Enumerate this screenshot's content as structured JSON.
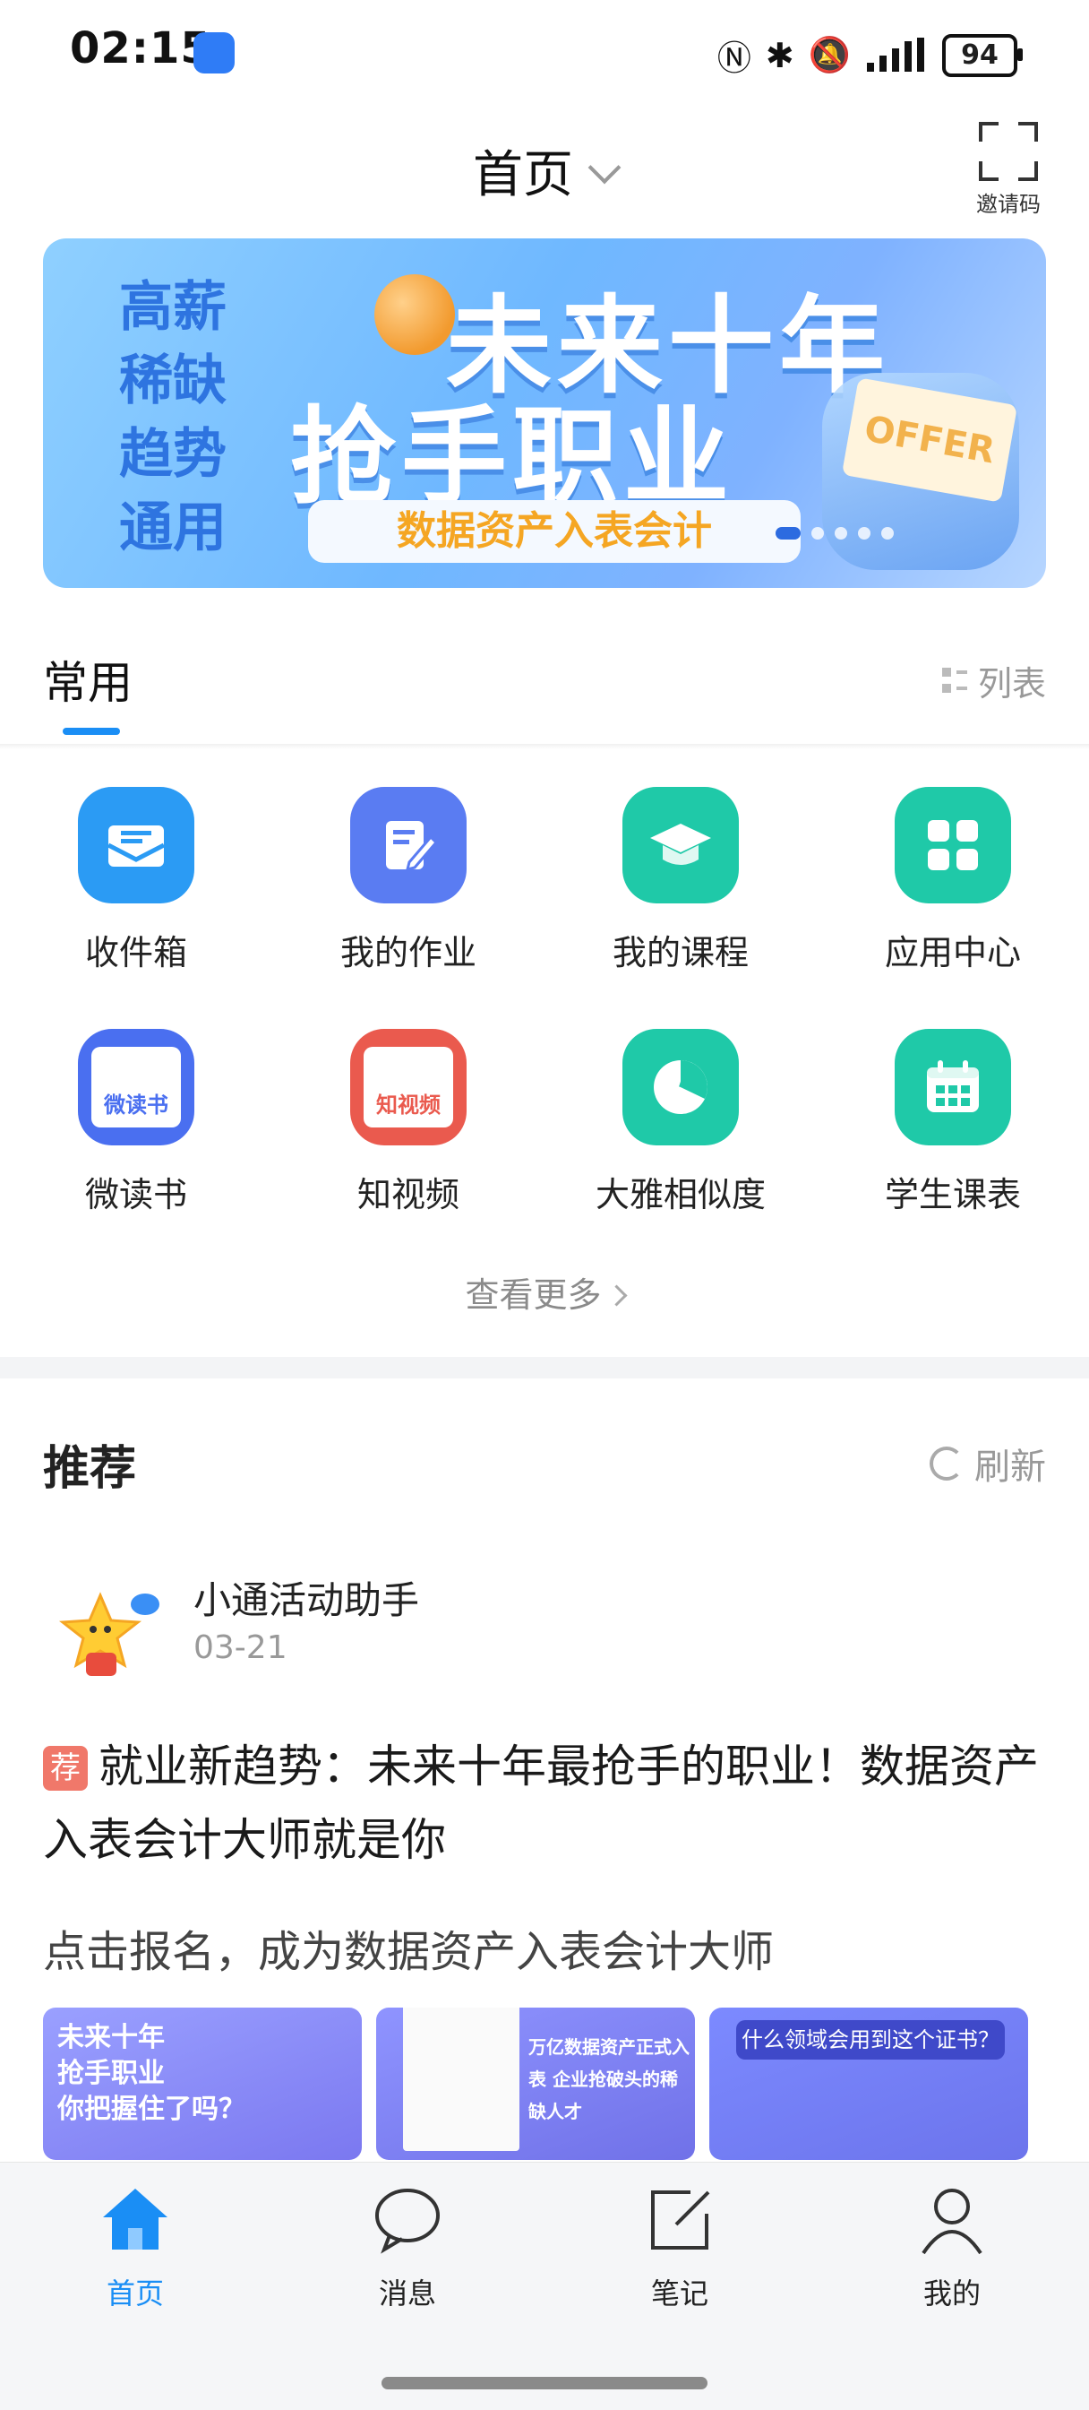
{
  "status_bar": {
    "time": "02:15",
    "battery": "94",
    "icons": [
      "nfc-icon",
      "bluetooth-icon",
      "mute-icon",
      "signal-icon"
    ]
  },
  "header": {
    "title": "首页",
    "invite_label": "邀请码"
  },
  "banner": {
    "side_text": [
      "高薪",
      "稀缺",
      "趋势",
      "通用"
    ],
    "line1": "未来十年",
    "line2": "抢手职业",
    "pill": "数据资产入表会计",
    "offer": "OFFER"
  },
  "common": {
    "title": "常用",
    "list_toggle": "列表",
    "apps": [
      {
        "label": "收件箱",
        "color": "#2b9bf4",
        "icon": "inbox-icon"
      },
      {
        "label": "我的作业",
        "color": "#5a7cf2",
        "icon": "homework-icon"
      },
      {
        "label": "我的课程",
        "color": "#1fc9a8",
        "icon": "course-icon"
      },
      {
        "label": "应用中心",
        "color": "#1fc9a8",
        "icon": "app-center-icon"
      },
      {
        "label": "微读书",
        "color": "#4a6ff0",
        "icon": "micro-reading-icon",
        "badge": "微读书"
      },
      {
        "label": "知视频",
        "color": "#ea5a4e",
        "icon": "video-icon",
        "badge": "知视频"
      },
      {
        "label": "大雅相似度",
        "color": "#1fc9a8",
        "icon": "similarity-icon"
      },
      {
        "label": "学生课表",
        "color": "#1fc9a8",
        "icon": "timetable-icon"
      }
    ],
    "more": "查看更多"
  },
  "recommend": {
    "title": "推荐",
    "refresh": "刷新",
    "author": "小通活动助手",
    "date": "03-21",
    "tag": "荐",
    "post_title": "就业新趋势：未来十年最抢手的职业！数据资产入表会计大师就是你",
    "post_sub": "点击报名，成为数据资产入表会计大师",
    "thumbs": [
      {
        "text": "未来十年\n抢手职业\n你把握住了吗？"
      },
      {
        "text": "万亿数据资产正式入表\n企业抢破头的稀缺人才"
      },
      {
        "text": "什么领域会用到这个证书？"
      }
    ]
  },
  "bottom_nav": {
    "items": [
      {
        "label": "首页",
        "active": true
      },
      {
        "label": "消息",
        "active": false
      },
      {
        "label": "笔记",
        "active": false
      },
      {
        "label": "我的",
        "active": false
      }
    ],
    "active_color": "#1a8ef5"
  }
}
